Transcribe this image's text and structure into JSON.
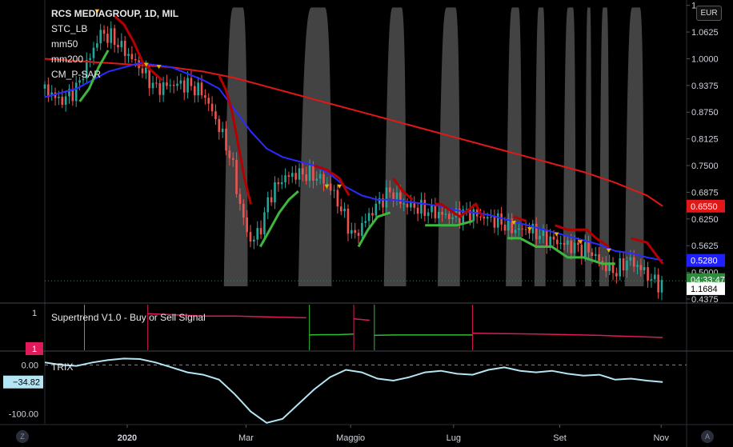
{
  "symbol_title": "RCS MEDIAGROUP, 1D, MIL",
  "currency": "EUR",
  "indicators": [
    "STC_LB",
    "mm50",
    "mm200",
    "CM_P-SAR"
  ],
  "supertrend_title": "Supertrend V1.0 - Buy or Sell Signal",
  "trix_title": "TRIX",
  "corner_left": "Z",
  "corner_right": "A",
  "colors": {
    "mm50": "#2b2bff",
    "mm200": "#e01818",
    "psar_up": "#3db83d",
    "psar_down": "#b50000",
    "stc": "#9a9a9a",
    "trix": "#b3e5f5",
    "supertrend_up": "#2dbf2d",
    "supertrend_down": "#e0195a",
    "up_candle": "#26a69a",
    "down_candle": "#ef5350"
  },
  "chart_data": [
    {
      "type": "line",
      "name": "price",
      "y_ticks": [
        "1",
        "1.0625",
        "1.0000",
        "0.9375",
        "0.8750",
        "0.8125",
        "0.7500",
        "0.6875",
        "0.6250",
        "0.5625",
        "0.5000",
        "0.4375"
      ],
      "y_tick_values": [
        1.125,
        1.0625,
        1.0,
        0.9375,
        0.875,
        0.8125,
        0.75,
        0.6875,
        0.625,
        0.5625,
        0.5,
        0.4375
      ],
      "ylim": [
        0.43,
        1.13
      ],
      "x_ticks": [
        "2020",
        "Mar",
        "Maggio",
        "Lug",
        "Set",
        "Nov"
      ],
      "x_tick_days": [
        52,
        127,
        193,
        258,
        325,
        389
      ],
      "xlim": [
        0,
        400
      ],
      "price_labels": {
        "mm200": "0.6550",
        "mm50": "0.5280",
        "countdown": "04:33:47",
        "last": "1.1684"
      },
      "close": [
        [
          0,
          0.93
        ],
        [
          10,
          0.9
        ],
        [
          20,
          0.93
        ],
        [
          28,
          1.0
        ],
        [
          35,
          1.06
        ],
        [
          42,
          1.05
        ],
        [
          50,
          1.02
        ],
        [
          60,
          0.98
        ],
        [
          70,
          0.93
        ],
        [
          80,
          0.94
        ],
        [
          90,
          0.94
        ],
        [
          100,
          0.92
        ],
        [
          110,
          0.84
        ],
        [
          118,
          0.76
        ],
        [
          124,
          0.64
        ],
        [
          130,
          0.57
        ],
        [
          136,
          0.6
        ],
        [
          142,
          0.68
        ],
        [
          150,
          0.72
        ],
        [
          158,
          0.73
        ],
        [
          166,
          0.73
        ],
        [
          174,
          0.72
        ],
        [
          180,
          0.7
        ],
        [
          188,
          0.64
        ],
        [
          195,
          0.58
        ],
        [
          202,
          0.62
        ],
        [
          210,
          0.66
        ],
        [
          218,
          0.69
        ],
        [
          226,
          0.66
        ],
        [
          236,
          0.65
        ],
        [
          246,
          0.64
        ],
        [
          256,
          0.63
        ],
        [
          266,
          0.64
        ],
        [
          276,
          0.63
        ],
        [
          286,
          0.62
        ],
        [
          296,
          0.6
        ],
        [
          306,
          0.6
        ],
        [
          316,
          0.58
        ],
        [
          324,
          0.57
        ],
        [
          334,
          0.56
        ],
        [
          344,
          0.55
        ],
        [
          352,
          0.52
        ],
        [
          360,
          0.5
        ],
        [
          368,
          0.53
        ],
        [
          376,
          0.51
        ],
        [
          384,
          0.48
        ],
        [
          390,
          0.47
        ]
      ],
      "mm50": [
        [
          0,
          0.91
        ],
        [
          20,
          0.93
        ],
        [
          40,
          0.97
        ],
        [
          60,
          0.99
        ],
        [
          80,
          0.98
        ],
        [
          100,
          0.95
        ],
        [
          110,
          0.93
        ],
        [
          120,
          0.88
        ],
        [
          130,
          0.83
        ],
        [
          140,
          0.79
        ],
        [
          150,
          0.77
        ],
        [
          160,
          0.76
        ],
        [
          170,
          0.75
        ],
        [
          180,
          0.73
        ],
        [
          190,
          0.7
        ],
        [
          200,
          0.68
        ],
        [
          210,
          0.67
        ],
        [
          220,
          0.67
        ],
        [
          230,
          0.665
        ],
        [
          240,
          0.66
        ],
        [
          250,
          0.655
        ],
        [
          260,
          0.645
        ],
        [
          270,
          0.64
        ],
        [
          280,
          0.635
        ],
        [
          290,
          0.625
        ],
        [
          300,
          0.615
        ],
        [
          310,
          0.605
        ],
        [
          320,
          0.595
        ],
        [
          330,
          0.585
        ],
        [
          340,
          0.575
        ],
        [
          350,
          0.565
        ],
        [
          360,
          0.55
        ],
        [
          370,
          0.545
        ],
        [
          380,
          0.535
        ],
        [
          390,
          0.528
        ]
      ],
      "mm200": [
        [
          0,
          1.0
        ],
        [
          40,
          0.99
        ],
        [
          80,
          0.98
        ],
        [
          100,
          0.97
        ],
        [
          120,
          0.955
        ],
        [
          140,
          0.935
        ],
        [
          160,
          0.915
        ],
        [
          180,
          0.895
        ],
        [
          200,
          0.875
        ],
        [
          220,
          0.855
        ],
        [
          240,
          0.835
        ],
        [
          260,
          0.815
        ],
        [
          280,
          0.795
        ],
        [
          300,
          0.775
        ],
        [
          320,
          0.755
        ],
        [
          340,
          0.735
        ],
        [
          360,
          0.71
        ],
        [
          380,
          0.68
        ],
        [
          390,
          0.655
        ]
      ],
      "psar_up": [
        [
          22,
          0.9
        ],
        [
          28,
          0.93
        ],
        [
          34,
          0.98
        ],
        [
          40,
          1.02
        ],
        [
          112,
          0.0
        ],
        [
          136,
          0.56
        ],
        [
          142,
          0.6
        ],
        [
          148,
          0.64
        ],
        [
          154,
          0.67
        ],
        [
          160,
          0.69
        ],
        [
          195,
          0.0
        ],
        [
          198,
          0.56
        ],
        [
          204,
          0.6
        ],
        [
          210,
          0.63
        ],
        [
          218,
          0.64
        ],
        [
          226,
          0.0
        ],
        [
          240,
          0.61
        ],
        [
          250,
          0.61
        ],
        [
          260,
          0.61
        ],
        [
          270,
          0.62
        ],
        [
          292,
          0.58
        ],
        [
          300,
          0.58
        ],
        [
          310,
          0.56
        ],
        [
          320,
          0.56
        ],
        [
          330,
          0.535
        ],
        [
          340,
          0.535
        ],
        [
          352,
          0.52
        ],
        [
          360,
          0.52
        ]
      ],
      "psar_down": [
        [
          44,
          1.1
        ],
        [
          50,
          1.08
        ],
        [
          56,
          1.04
        ],
        [
          62,
          0.99
        ],
        [
          68,
          0.97
        ],
        [
          74,
          0.95
        ],
        [
          110,
          0.96
        ],
        [
          114,
          0.93
        ],
        [
          118,
          0.88
        ],
        [
          122,
          0.8
        ],
        [
          126,
          0.72
        ],
        [
          130,
          0.66
        ],
        [
          170,
          0.75
        ],
        [
          178,
          0.74
        ],
        [
          186,
          0.72
        ],
        [
          192,
          0.68
        ],
        [
          220,
          0.72
        ],
        [
          226,
          0.69
        ],
        [
          232,
          0.67
        ],
        [
          246,
          0.66
        ],
        [
          250,
          0.66
        ],
        [
          262,
          0.63
        ],
        [
          272,
          0.66
        ],
        [
          276,
          0.63
        ],
        [
          296,
          0.63
        ],
        [
          304,
          0.62
        ],
        [
          322,
          0.61
        ],
        [
          330,
          0.6
        ],
        [
          342,
          0.6
        ],
        [
          348,
          0.58
        ],
        [
          356,
          0.56
        ],
        [
          370,
          0.58
        ],
        [
          380,
          0.57
        ],
        [
          390,
          0.52
        ]
      ],
      "stc_regions": [
        [
          113,
          128
        ],
        [
          160,
          181
        ],
        [
          214,
          228
        ],
        [
          248,
          262
        ],
        [
          291,
          301
        ],
        [
          309,
          316
        ],
        [
          327,
          335
        ],
        [
          341,
          345
        ],
        [
          350,
          356
        ],
        [
          366,
          378
        ]
      ]
    },
    {
      "type": "line",
      "name": "supertrend",
      "y_ticks": [
        "1"
      ],
      "trend_label": "1",
      "up_segments": [
        [
          [
            167,
            0.35
          ],
          [
            175,
            0.36
          ],
          [
            185,
            0.36
          ],
          [
            195,
            0.38
          ]
        ],
        [
          [
            208,
            0.34
          ],
          [
            220,
            0.35
          ],
          [
            235,
            0.35
          ],
          [
            255,
            0.35
          ],
          [
            270,
            0.35
          ]
        ]
      ],
      "down_segments": [
        [
          [
            65,
            0.97
          ],
          [
            100,
            0.9
          ],
          [
            120,
            0.9
          ],
          [
            140,
            0.88
          ],
          [
            165,
            0.85
          ]
        ],
        [
          [
            195,
            0.82
          ],
          [
            205,
            0.78
          ]
        ],
        [
          [
            270,
            0.4
          ],
          [
            290,
            0.39
          ],
          [
            310,
            0.38
          ],
          [
            330,
            0.36
          ],
          [
            350,
            0.34
          ],
          [
            370,
            0.31
          ],
          [
            390,
            0.28
          ]
        ]
      ],
      "spikes": [
        [
          25,
          0.0
        ],
        [
          65,
          1.0
        ],
        [
          167,
          0.0
        ],
        [
          195,
          1.0
        ],
        [
          208,
          0.0
        ],
        [
          270,
          1.0
        ]
      ]
    },
    {
      "type": "line",
      "name": "trix",
      "y_ticks": [
        "0.00",
        "-100.00"
      ],
      "y_tick_values": [
        0,
        -100
      ],
      "current_label": "−34.82",
      "ylim": [
        -120,
        25
      ],
      "values": [
        [
          0,
          5
        ],
        [
          10,
          0
        ],
        [
          20,
          -2
        ],
        [
          30,
          5
        ],
        [
          40,
          10
        ],
        [
          50,
          13
        ],
        [
          60,
          12
        ],
        [
          70,
          5
        ],
        [
          80,
          -5
        ],
        [
          90,
          -15
        ],
        [
          100,
          -20
        ],
        [
          110,
          -30
        ],
        [
          120,
          -60
        ],
        [
          130,
          -95
        ],
        [
          140,
          -118
        ],
        [
          150,
          -110
        ],
        [
          160,
          -80
        ],
        [
          170,
          -50
        ],
        [
          180,
          -25
        ],
        [
          190,
          -10
        ],
        [
          200,
          -15
        ],
        [
          210,
          -28
        ],
        [
          220,
          -32
        ],
        [
          230,
          -25
        ],
        [
          240,
          -15
        ],
        [
          250,
          -12
        ],
        [
          260,
          -18
        ],
        [
          270,
          -20
        ],
        [
          280,
          -10
        ],
        [
          290,
          -5
        ],
        [
          300,
          -12
        ],
        [
          310,
          -15
        ],
        [
          320,
          -12
        ],
        [
          330,
          -18
        ],
        [
          340,
          -22
        ],
        [
          350,
          -20
        ],
        [
          360,
          -30
        ],
        [
          370,
          -28
        ],
        [
          380,
          -32
        ],
        [
          390,
          -35
        ]
      ]
    }
  ]
}
